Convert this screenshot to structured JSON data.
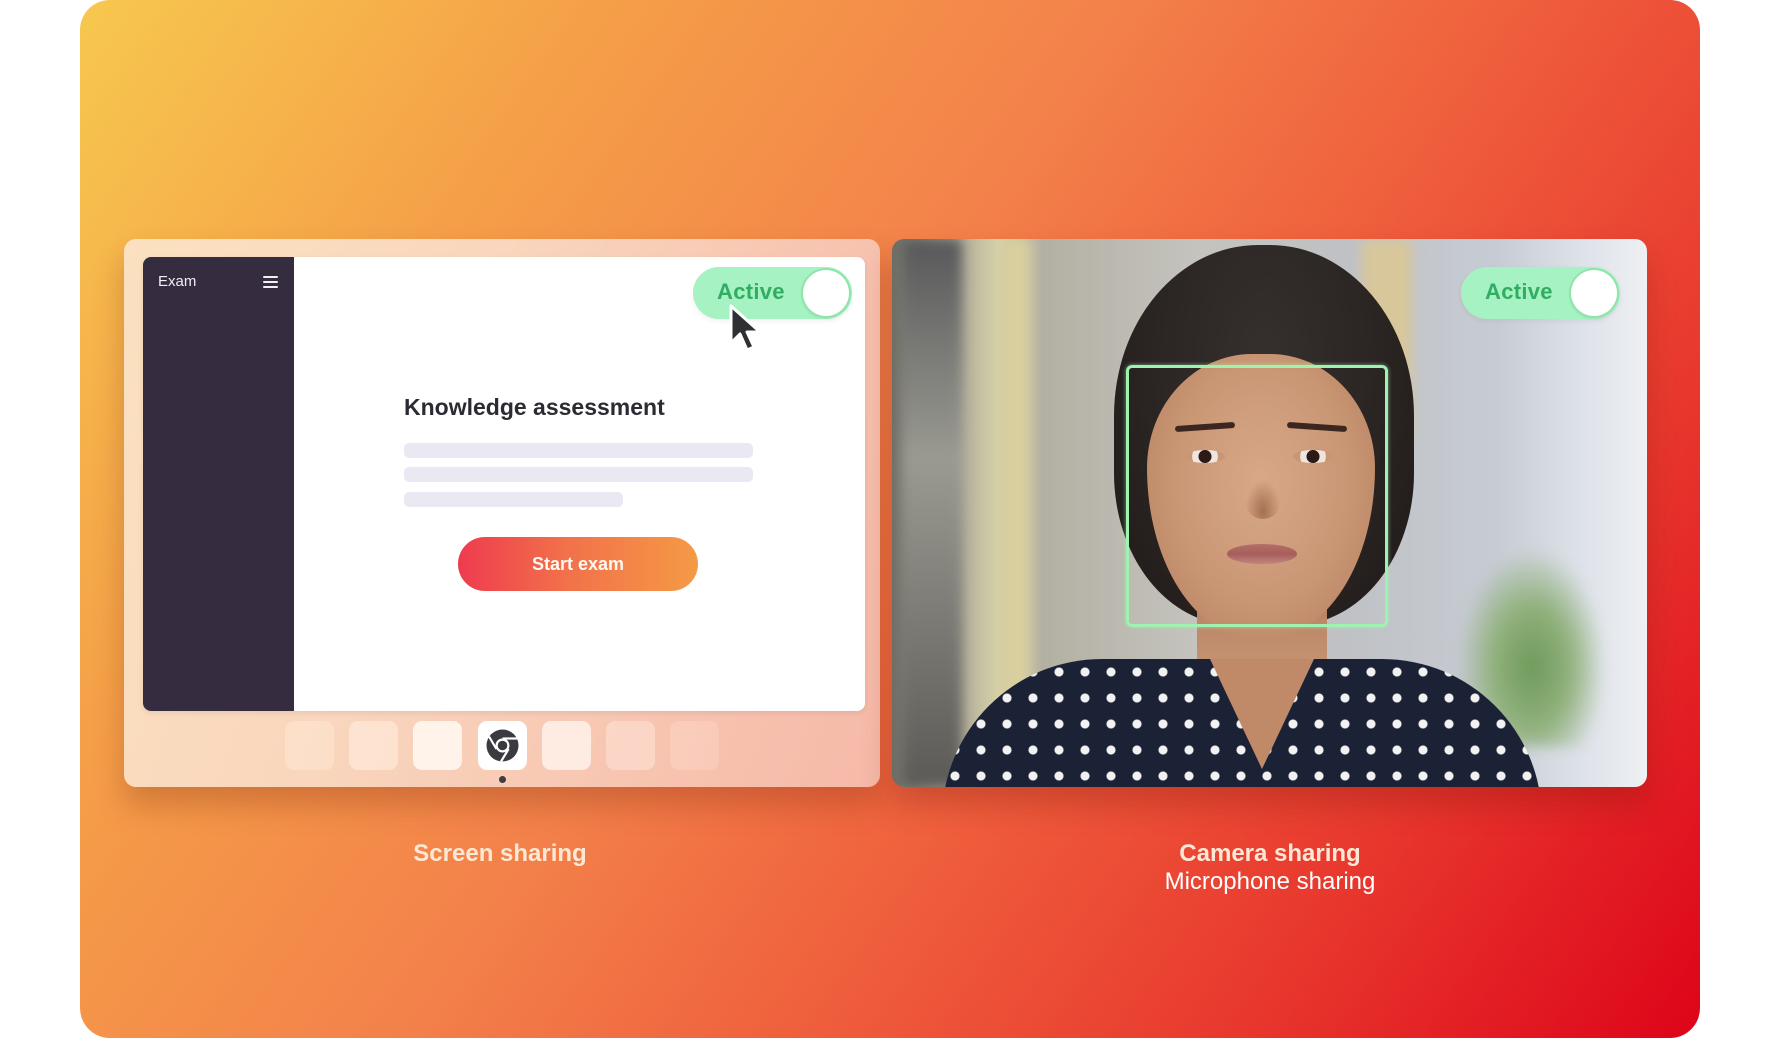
{
  "screen_panel": {
    "app": {
      "sidebar_title": "Exam",
      "menu_icon": "hamburger-menu-icon",
      "heading": "Knowledge assessment",
      "placeholder_lines": 3,
      "start_button_label": "Start exam"
    },
    "toggle": {
      "label": "Active",
      "state": "on"
    },
    "dock": {
      "items": [
        {
          "icon": "blank-app-icon"
        },
        {
          "icon": "blank-app-icon"
        },
        {
          "icon": "blank-app-icon"
        },
        {
          "icon": "chrome-icon",
          "active": true
        },
        {
          "icon": "blank-app-icon"
        },
        {
          "icon": "blank-app-icon"
        },
        {
          "icon": "blank-app-icon"
        }
      ]
    },
    "caption": "Screen sharing"
  },
  "camera_panel": {
    "toggle": {
      "label": "Active",
      "state": "on"
    },
    "face_detection": "face-bounding-box",
    "caption_line1": "Camera sharing",
    "caption_line2": "Microphone sharing"
  },
  "colors": {
    "gradient_start": "#f7c84e",
    "gradient_mid": "#f3804a",
    "gradient_end": "#dd0419",
    "toggle_bg": "#a6f2c2",
    "toggle_text": "#2fae63",
    "sidebar_bg": "#352c40",
    "button_start": "#ee3b4f",
    "button_end": "#f59a45",
    "face_box": "#9ff2b0"
  }
}
